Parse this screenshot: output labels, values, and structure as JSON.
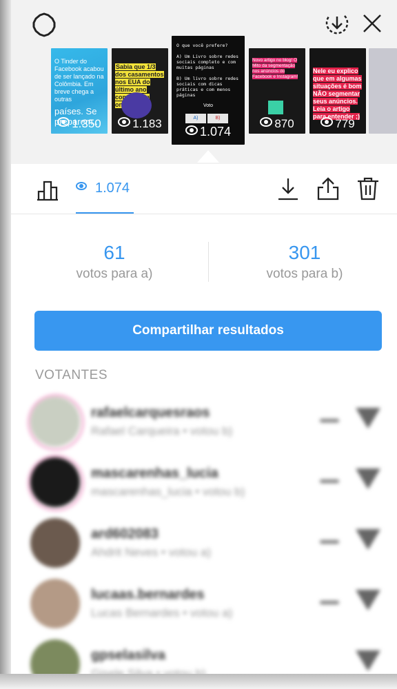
{
  "header": {
    "stories": [
      {
        "text_top": "O Tinder do Facebook acabou de ser lançado na Colômbia. Em breve chega a outras",
        "text_big": "países. Se preparem..",
        "views": "1.350"
      },
      {
        "text": "Sabia que 1/3 dos casamentos nos EUA do último ano começaram online?",
        "views": "1.183"
      },
      {
        "text": "O que você prefere?\n\nA) Um Livro sobre redes sociais completo e com muitas páginas\n\nB) Um livro sobre redes sociais com dicas práticas e com menos páginas",
        "vote_label": "Voto",
        "option_a": "A)",
        "option_b": "B)",
        "views": "1.074"
      },
      {
        "text": "Novo artigo no blog! O Mito da segmentação nos anúncios do Facebook e Instagram!",
        "views": "870"
      },
      {
        "text": "Nele eu explico que em algumas situações é bom NÃO segmentar seus anúncios. Leia o artigo para entender ;)",
        "views": "779"
      },
      {
        "text": "",
        "views": ""
      }
    ]
  },
  "toolbar": {
    "views": "1.074"
  },
  "results": {
    "a_count": "61",
    "a_label": "votos para a)",
    "b_count": "301",
    "b_label": "votos para b)"
  },
  "share_button": "Compartilhar resultados",
  "voters_title": "VOTANTES",
  "voters": [
    {
      "name": "rafaelcarquesraos",
      "sub": "Rafael Carqueira • votou b)"
    },
    {
      "name": "mascarenhas_lucia",
      "sub": "mascarenhas_lucia • votou b)"
    },
    {
      "name": "ard602083",
      "sub": "Ahdrit Neves • votou a)"
    },
    {
      "name": "lucaas.bernardes",
      "sub": "Lucas Bernardes • votou a)"
    },
    {
      "name": "gpselasilva",
      "sub": "Gisele Silva • votou b)"
    }
  ]
}
